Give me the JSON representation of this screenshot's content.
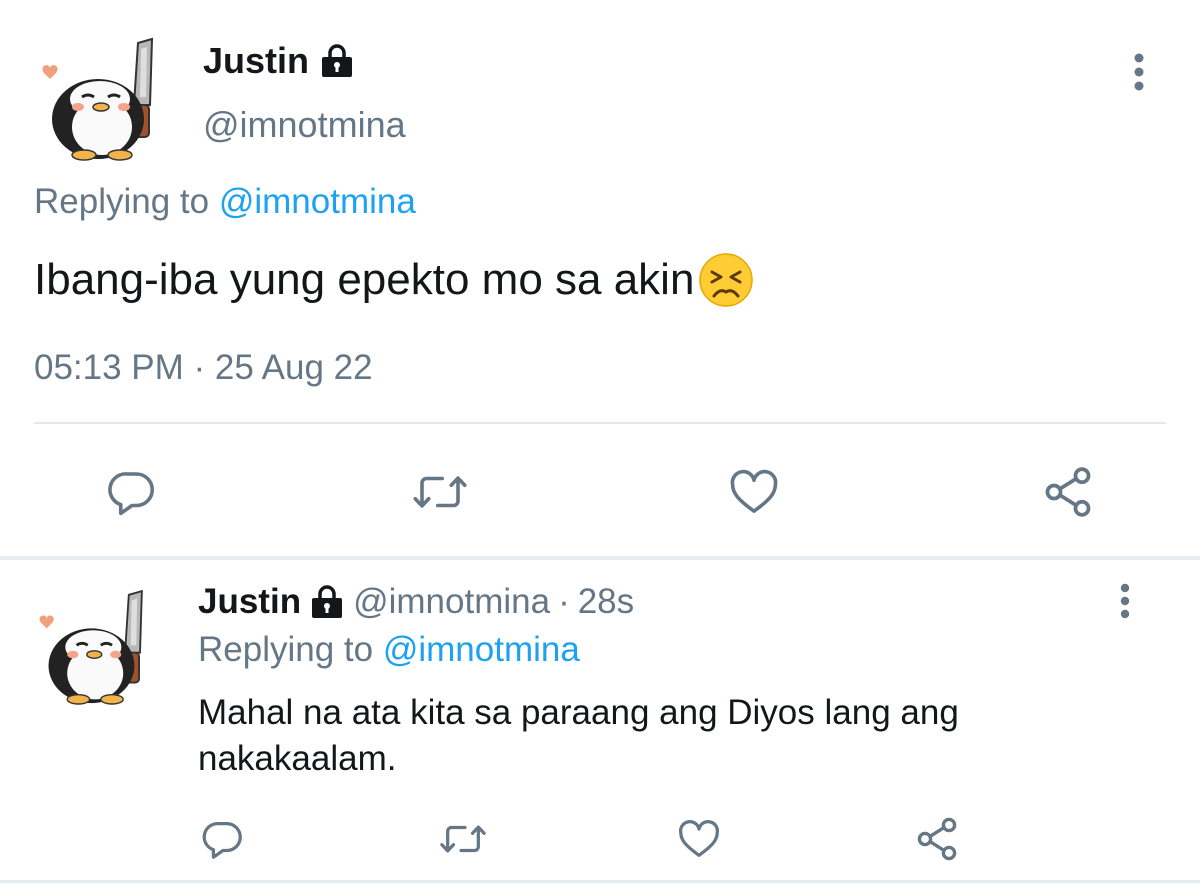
{
  "colors": {
    "text_primary": "#14171a",
    "text_secondary": "#657786",
    "link": "#1da1f2",
    "divider": "#e1e8ed"
  },
  "main_tweet": {
    "author_name": "Justin",
    "author_handle": "@imnotmina",
    "protected_icon": "lock-icon",
    "replying_prefix": "Replying to",
    "replying_to": "@imnotmina",
    "text": "Ibang-iba yung epekto mo sa akin",
    "emoji": "persevering-face",
    "timestamp": "05:13 PM · 25 Aug 22",
    "actions": [
      "reply-icon",
      "retweet-icon",
      "like-icon",
      "share-icon"
    ]
  },
  "reply_tweet": {
    "author_name": "Justin",
    "author_handle": "@imnotmina",
    "separator": "·",
    "age": "28s",
    "protected_icon": "lock-icon",
    "replying_prefix": "Replying to",
    "replying_to": "@imnotmina",
    "text": "Mahal na ata kita sa paraang ang Diyos lang ang nakakaalam.",
    "actions": [
      "reply-icon",
      "retweet-icon",
      "like-icon",
      "share-icon"
    ]
  }
}
